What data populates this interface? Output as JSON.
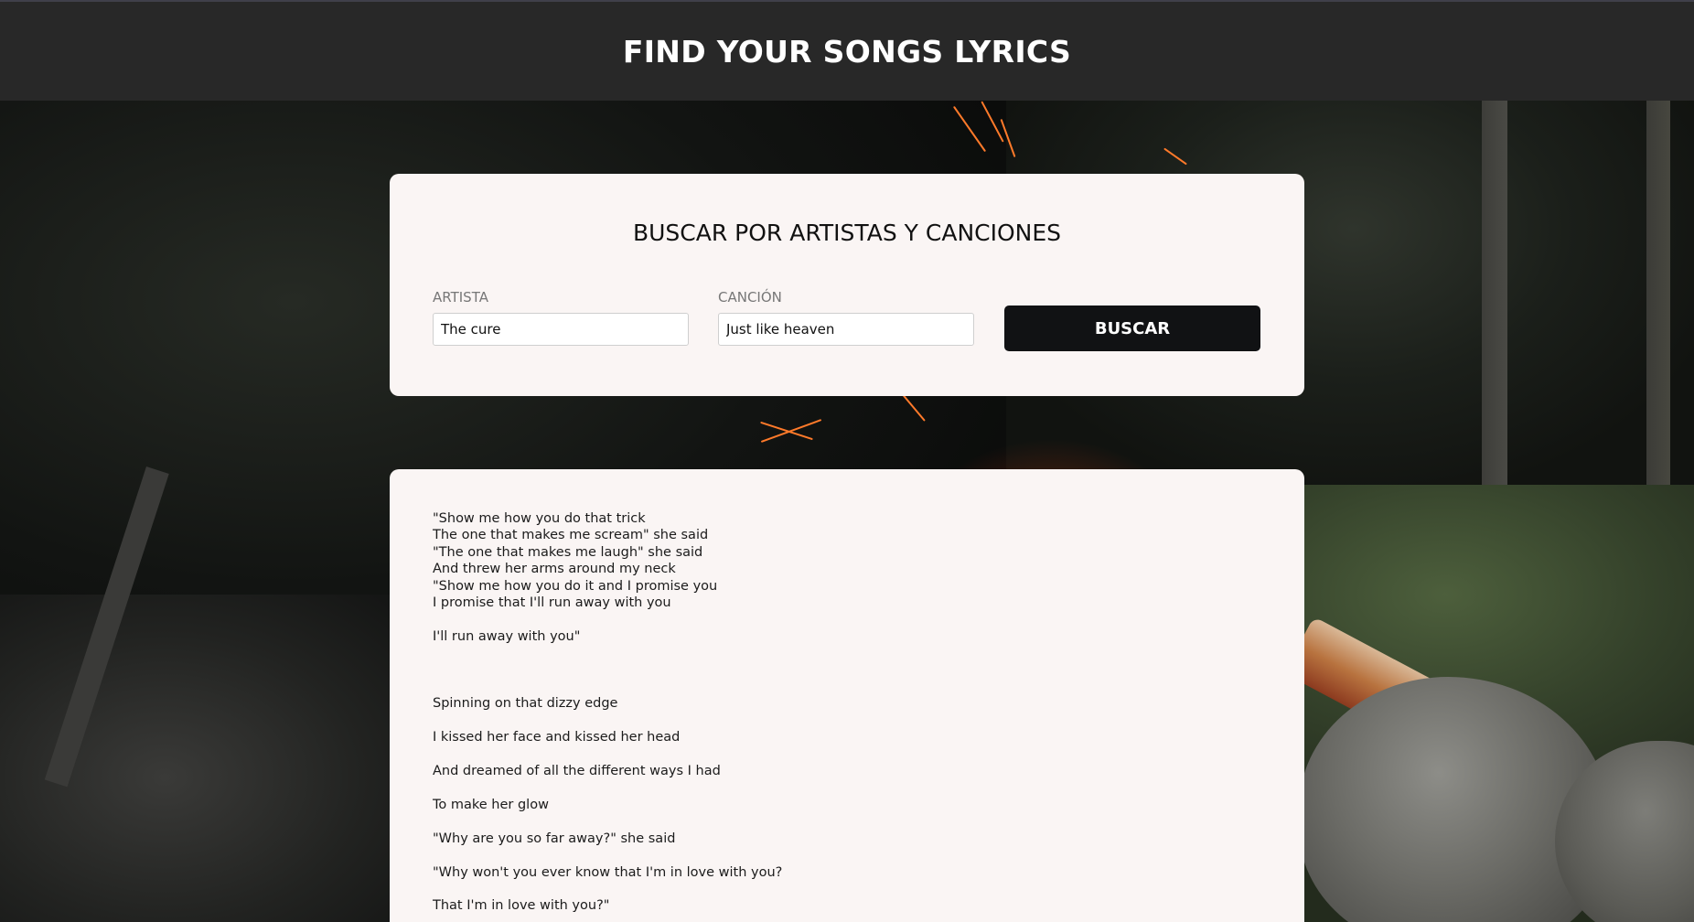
{
  "header": {
    "title": "FIND YOUR SONGS LYRICS"
  },
  "search": {
    "title": "BUSCAR POR ARTISTAS Y CANCIONES",
    "artist_label": "ARTISTA",
    "artist_value": "The cure",
    "song_label": "CANCIÓN",
    "song_value": "Just like heaven",
    "button_label": "BUSCAR"
  },
  "lyrics": {
    "text": "\"Show me how you do that trick\nThe one that makes me scream\" she said\n\"The one that makes me laugh\" she said\nAnd threw her arms around my neck\n\"Show me how you do it and I promise you\nI promise that I'll run away with you\n\nI'll run away with you\"\n\n\n\nSpinning on that dizzy edge\n\nI kissed her face and kissed her head\n\nAnd dreamed of all the different ways I had\n\nTo make her glow\n\n\"Why are you so far away?\" she said\n\n\"Why won't you ever know that I'm in love with you?\n\nThat I'm in love with you?\""
  }
}
